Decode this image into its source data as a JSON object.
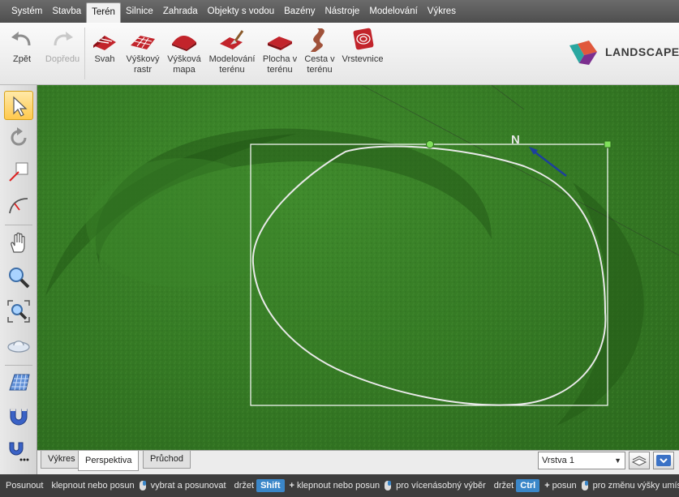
{
  "menu": {
    "items": [
      {
        "label": "Systém",
        "active": false
      },
      {
        "label": "Stavba",
        "active": false
      },
      {
        "label": "Terén",
        "active": true
      },
      {
        "label": "Silnice",
        "active": false
      },
      {
        "label": "Zahrada",
        "active": false
      },
      {
        "label": "Objekty s vodou",
        "active": false
      },
      {
        "label": "Bazény",
        "active": false
      },
      {
        "label": "Nástroje",
        "active": false
      },
      {
        "label": "Modelování",
        "active": false
      },
      {
        "label": "Výkres",
        "active": false
      }
    ]
  },
  "ribbon": {
    "undo_label": "Zpět",
    "redo_label": "Dopředu",
    "buttons": [
      {
        "line1": "Svah",
        "line2": ""
      },
      {
        "line1": "Výškový",
        "line2": "rastr"
      },
      {
        "line1": "Výšková",
        "line2": "mapa"
      },
      {
        "line1": "Modelování",
        "line2": "terénu"
      },
      {
        "line1": "Plocha v",
        "line2": "terénu"
      },
      {
        "line1": "Cesta v",
        "line2": "terénu"
      },
      {
        "line1": "Vrstevnice",
        "line2": ""
      }
    ],
    "brand_text": "LANDSCAPE"
  },
  "toolbar": {
    "tools": [
      "select-icon",
      "rotate-icon",
      "measure-icon",
      "arc-icon",
      "hand-pan-icon",
      "zoom-icon",
      "zoom-extents-icon",
      "orbit-icon",
      "grid-icon",
      "magnet-icon",
      "magnet-settings-icon"
    ]
  },
  "viewport": {
    "compass_letter": "N"
  },
  "tabs": {
    "items": [
      "Výkres",
      "Perspektiva",
      "Průchod"
    ],
    "active": "Perspektiva",
    "layer_value": "Vrstva 1"
  },
  "status": {
    "posunout": "Posunout",
    "hint1a": "klepnout nebo posun",
    "hint1b": "vybrat a posunovat",
    "hold1": "držet",
    "shift_key": "Shift",
    "hint2a": "klepnout nebo posun",
    "hint2b": "pro vícenásobný výběr",
    "hold2": "držet",
    "ctrl_key": "Ctrl",
    "hint3a": "posun",
    "hint3b": "pro změnu výšky umístě"
  },
  "colors": {
    "grass": "#367b25",
    "accent_selected": "#ffc94d",
    "status_key": "#3b87c9",
    "handle_green": "#7fe05a"
  }
}
